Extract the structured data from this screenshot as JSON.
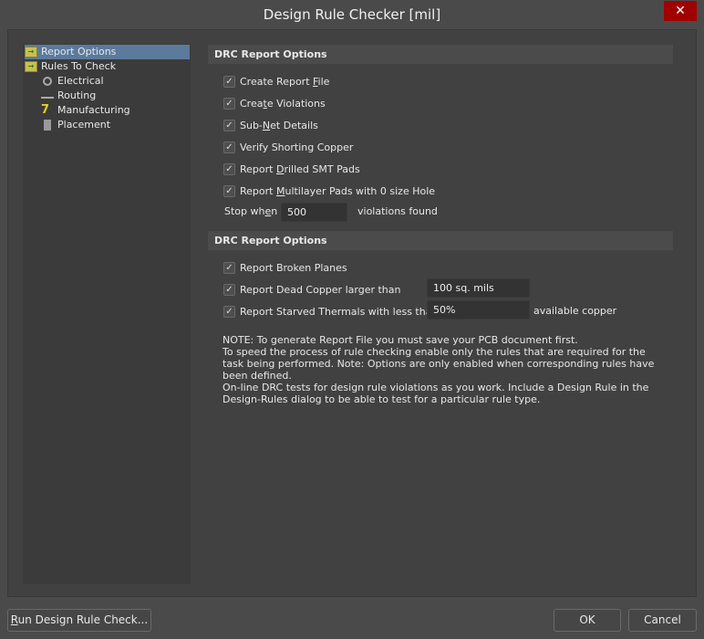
{
  "window": {
    "title": "Design Rule Checker [mil]",
    "close": "✕"
  },
  "tree": [
    {
      "label": "Report Options",
      "icon": "folder-icon"
    },
    {
      "label": "Rules To Check",
      "icon": "folder-icon"
    },
    {
      "label": "Electrical",
      "icon": "electrical-icon"
    },
    {
      "label": "Routing",
      "icon": "routing-icon"
    },
    {
      "label": "Manufacturing",
      "icon": "manufacturing-icon"
    },
    {
      "label": "Placement",
      "icon": "placement-icon"
    }
  ],
  "section1": {
    "title": "DRC Report Options",
    "options": [
      {
        "pre": "Create Report ",
        "key": "F",
        "post": "ile",
        "checked": true
      },
      {
        "pre": "Crea",
        "key": "t",
        "post": "e Violations",
        "checked": true
      },
      {
        "pre": "Sub-",
        "key": "N",
        "post": "et Details",
        "checked": true
      },
      {
        "pre": "Verify Shorting Copper",
        "key": "",
        "post": "",
        "checked": true
      },
      {
        "pre": "Report ",
        "key": "D",
        "post": "rilled SMT Pads",
        "checked": true
      },
      {
        "pre": "Report ",
        "key": "M",
        "post": "ultilayer Pads with 0 size Hole",
        "checked": true
      }
    ],
    "stop_pre": "Stop wh",
    "stop_key": "e",
    "stop_post": "n",
    "stop_value": "500",
    "stop_suffix": "violations found"
  },
  "section2": {
    "title": "DRC Report Options",
    "broken": "Report Broken Planes",
    "dead": "Report Dead Copper larger than",
    "dead_value": "100 sq. mils",
    "starved": "Report Starved Thermals with less than",
    "starved_value": "50%",
    "starved_suffix": "available copper"
  },
  "note": [
    "NOTE: To generate Report File you must save your PCB document first.",
    "To speed the process of rule checking enable only the rules that are required for the task being performed.  Note: Options are only enabled when corresponding rules have been defined.",
    "On-line DRC tests for design rule violations as you work. Include a Design Rule in the Design-Rules dialog to be able to test for a particular rule  type."
  ],
  "buttons": {
    "run_key": "R",
    "run_rest": "un Design Rule Check...",
    "ok": "OK",
    "cancel": "Cancel"
  },
  "check_mark": "✓"
}
